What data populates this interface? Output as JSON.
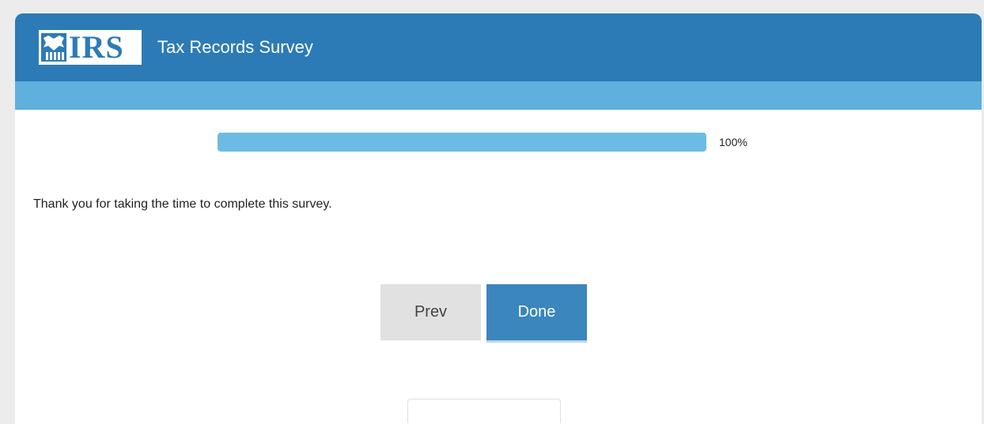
{
  "header": {
    "logo_text": "IRS",
    "logo_icon": "irs-eagle-icon",
    "title": "Tax Records Survey"
  },
  "progress": {
    "value": 1.0,
    "label": "100%"
  },
  "main": {
    "message": "Thank you for taking the time to complete this survey."
  },
  "buttons": {
    "prev_label": "Prev",
    "done_label": "Done"
  },
  "colors": {
    "header": "#2c7bb6",
    "subbar": "#5fb0dc",
    "progress_fill": "#6cbbe5",
    "done_button": "#3a86bd",
    "prev_button": "#e1e1e1"
  }
}
